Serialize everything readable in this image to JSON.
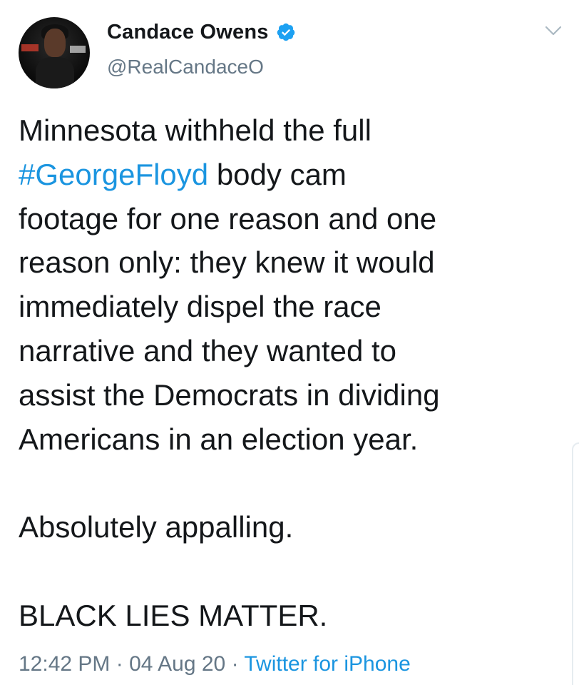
{
  "author": {
    "display_name": "Candace Owens",
    "handle": "@RealCandaceO",
    "verified": true,
    "avatar_icon": "profile-photo"
  },
  "tweet": {
    "lines": [
      {
        "text": "Minnesota withheld the full"
      },
      {
        "hashtag": "#GeorgeFloyd",
        "text": " body cam"
      },
      {
        "text": "footage for one reason and one"
      },
      {
        "text": "reason only: they knew it would"
      },
      {
        "text": "immediately dispel the race"
      },
      {
        "text": "narrative and they wanted to"
      },
      {
        "text": "assist the Democrats in dividing"
      },
      {
        "text": "Americans in an election year."
      }
    ],
    "paragraph2": "Absolutely appalling.",
    "paragraph3": "BLACK LIES MATTER."
  },
  "meta": {
    "time": "12:42 PM",
    "separator": " · ",
    "date": "04 Aug 20",
    "source": "Twitter for iPhone"
  },
  "icons": {
    "verified": "verified-badge-icon",
    "menu": "chevron-down-icon"
  },
  "colors": {
    "link": "#1b95e0",
    "verified": "#1da1f2",
    "secondary_text": "#657786",
    "primary_text": "#14171a"
  }
}
